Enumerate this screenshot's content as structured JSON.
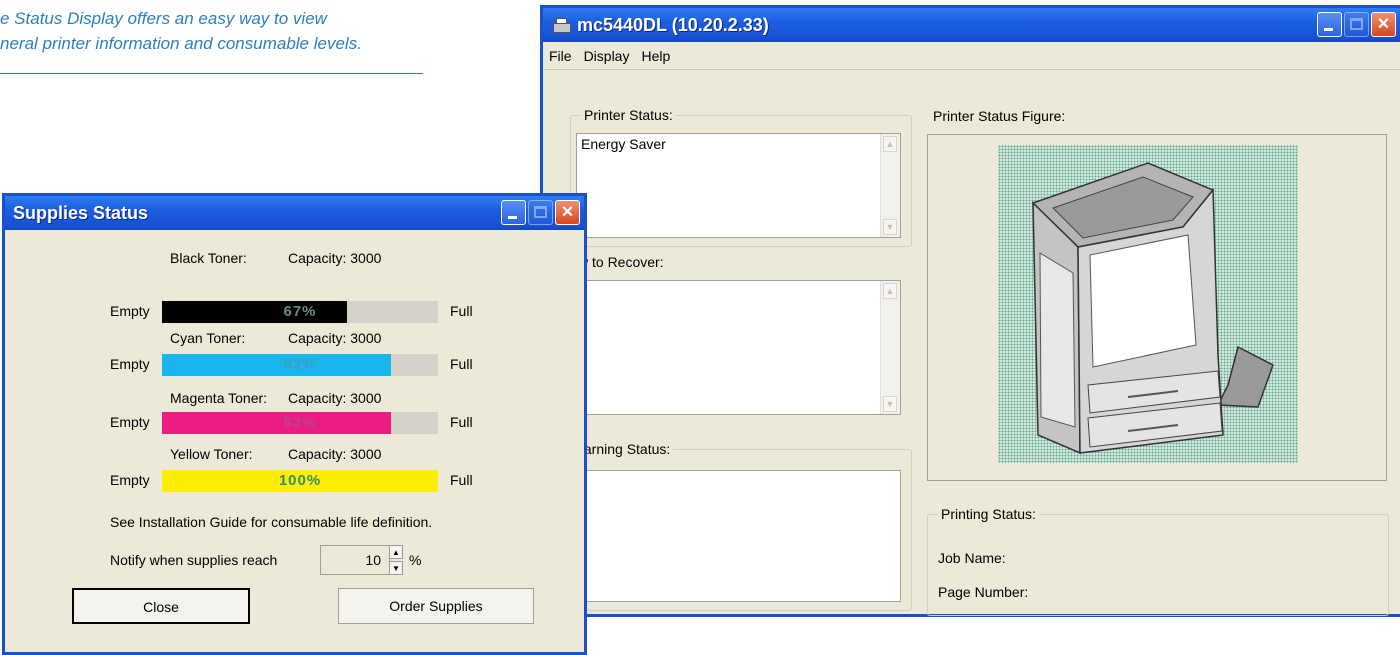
{
  "caption": {
    "line1": "e Status Display offers an easy way to view",
    "line2": "neral printer information and consumable levels."
  },
  "main_window": {
    "title": "mc5440DL (10.20.2.33)",
    "menu": [
      "File",
      "Display",
      "Help"
    ],
    "printer_status": {
      "label": "Printer Status:",
      "value": "Energy Saver"
    },
    "how_to_recover": {
      "label": "w to Recover:"
    },
    "warning_status": {
      "label": "/arning Status:"
    },
    "figure": {
      "label": "Printer Status Figure:"
    },
    "printing_status": {
      "label": "Printing Status:",
      "job_name_label": "Job Name:",
      "page_number_label": "Page Number:"
    }
  },
  "supplies_window": {
    "title": "Supplies Status",
    "empty_label": "Empty",
    "full_label": "Full",
    "toners": [
      {
        "name": "Black Toner:",
        "capacity": "Capacity: 3000",
        "percent_text": "67%",
        "level": 0.67,
        "color": "#000000",
        "text_color": "#6a8a8a"
      },
      {
        "name": "Cyan Toner:",
        "capacity": "Capacity: 3000",
        "percent_text": "82%",
        "level": 0.83,
        "color": "#19b6ee",
        "text_color": "#3d9fc0"
      },
      {
        "name": "Magenta Toner:",
        "capacity": "Capacity: 3000",
        "percent_text": "83%",
        "level": 0.83,
        "color": "#ea1e82",
        "text_color": "#c0408a"
      },
      {
        "name": "Yellow Toner:",
        "capacity": "Capacity: 3000",
        "percent_text": "100%",
        "level": 1.0,
        "color": "#ffee00",
        "text_color": "#2f8f6f"
      }
    ],
    "note": "See Installation Guide for consumable life definition.",
    "notify_label": "Notify when supplies reach",
    "notify_value": "10",
    "notify_unit": "%",
    "close_button": "Close",
    "order_button": "Order Supplies"
  }
}
